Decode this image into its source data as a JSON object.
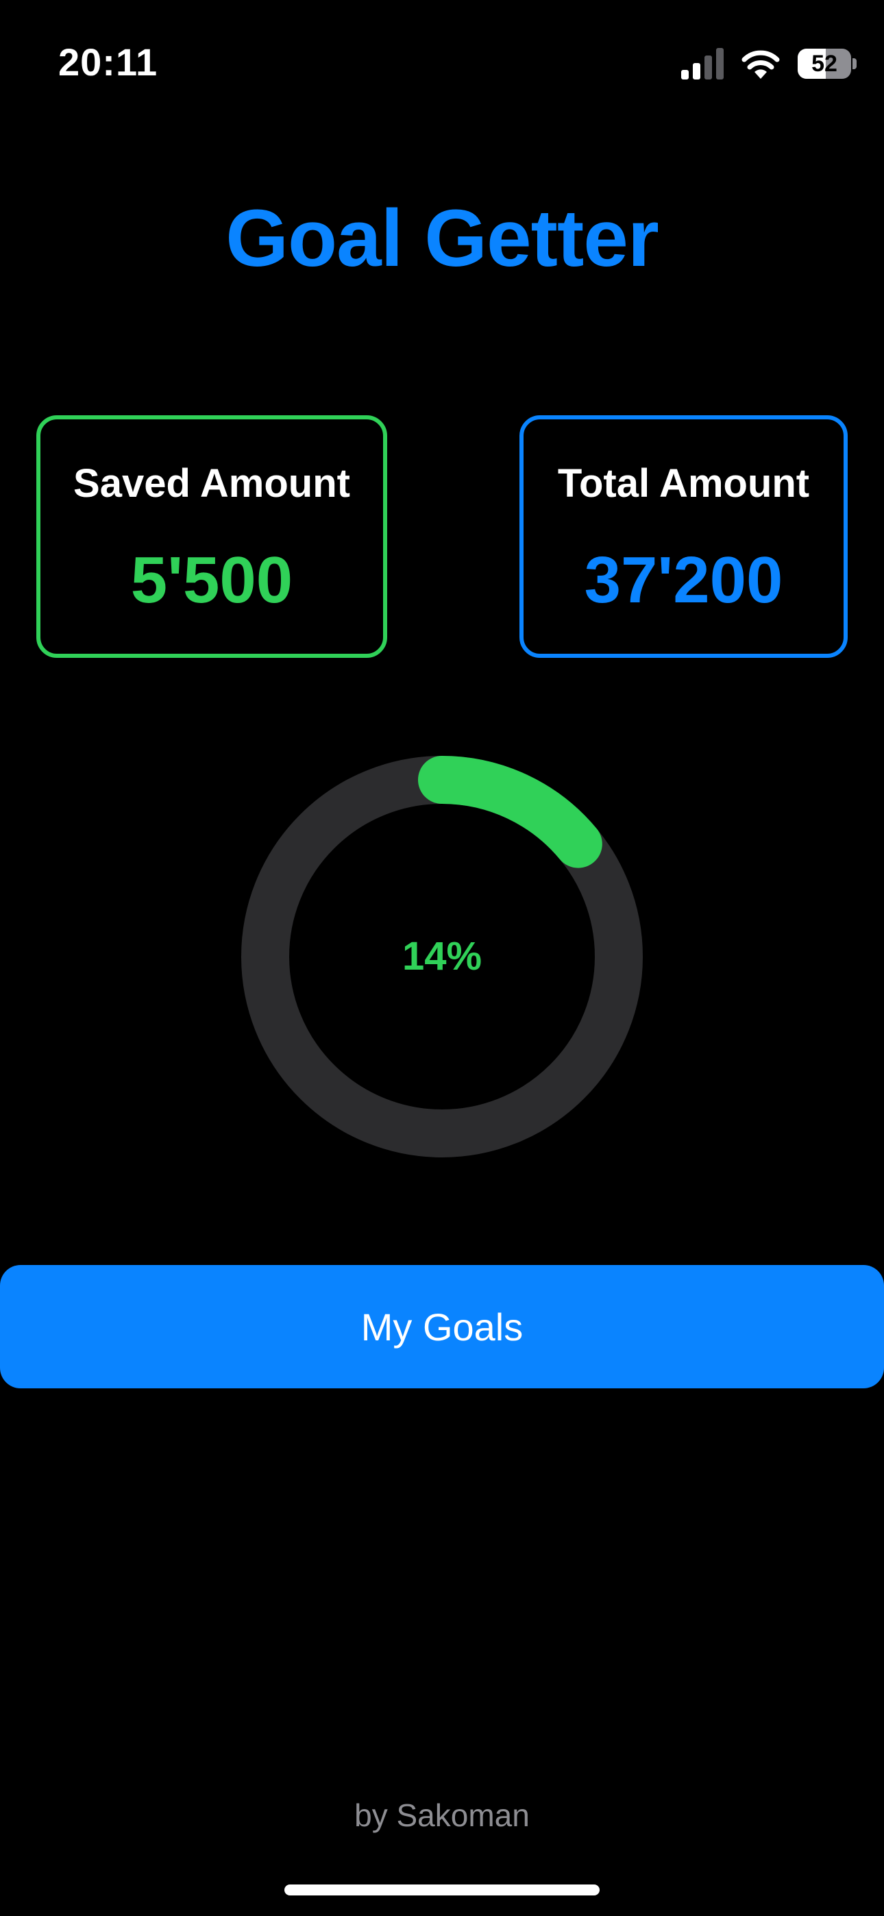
{
  "status_bar": {
    "time": "20:11",
    "signal_icon": "cellular-signal-icon",
    "signal_bars_active": 2,
    "signal_bars_total": 4,
    "wifi_icon": "wifi-icon",
    "battery_icon": "battery-icon",
    "battery_level": "52"
  },
  "header": {
    "title": "Goal Getter"
  },
  "cards": {
    "saved": {
      "label": "Saved Amount",
      "value": "5'500"
    },
    "total": {
      "label": "Total Amount",
      "value": "37'200"
    }
  },
  "progress": {
    "percent_label": "14%",
    "fraction": 0.14
  },
  "actions": {
    "my_goals_label": "My Goals"
  },
  "footer": {
    "credit": "by Sakoman"
  },
  "colors": {
    "background": "#000000",
    "accent_blue": "#0a84ff",
    "accent_green": "#30d158",
    "ring_track": "#2c2c2e",
    "muted_text": "#8e8e93"
  }
}
